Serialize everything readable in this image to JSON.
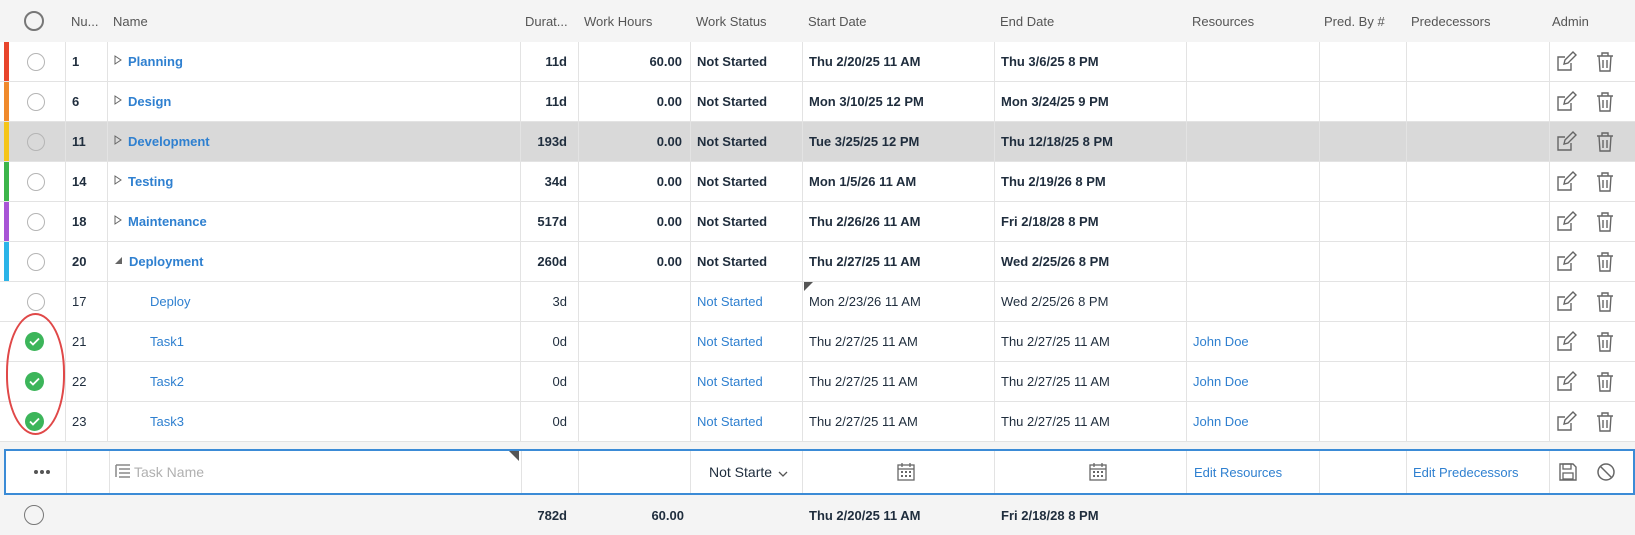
{
  "header": {
    "num": "Nu...",
    "name": "Name",
    "duration": "Durat...",
    "work_hours": "Work Hours",
    "work_status": "Work Status",
    "start_date": "Start Date",
    "end_date": "End Date",
    "resources": "Resources",
    "pred_by": "Pred. By #",
    "predecessors": "Predecessors",
    "admin": "Admin"
  },
  "rows": [
    {
      "num": "1",
      "name": "Planning",
      "duration": "11d",
      "work_hours": "60.00",
      "status": "Not Started",
      "start": "Thu 2/20/25 11 AM",
      "end": "Thu 3/6/25 8 PM",
      "resources": "",
      "color": "#e8452c",
      "expand": "collapsed"
    },
    {
      "num": "6",
      "name": "Design",
      "duration": "11d",
      "work_hours": "0.00",
      "status": "Not Started",
      "start": "Mon 3/10/25 12 PM",
      "end": "Mon 3/24/25 9 PM",
      "resources": "",
      "color": "#f08a2c",
      "expand": "collapsed"
    },
    {
      "num": "11",
      "name": "Development",
      "duration": "193d",
      "work_hours": "0.00",
      "status": "Not Started",
      "start": "Tue 3/25/25 12 PM",
      "end": "Thu 12/18/25 8 PM",
      "resources": "",
      "color": "#f5c518",
      "expand": "collapsed"
    },
    {
      "num": "14",
      "name": "Testing",
      "duration": "34d",
      "work_hours": "0.00",
      "status": "Not Started",
      "start": "Mon 1/5/26 11 AM",
      "end": "Thu 2/19/26 8 PM",
      "resources": "",
      "color": "#3cb54a",
      "expand": "collapsed"
    },
    {
      "num": "18",
      "name": "Maintenance",
      "duration": "517d",
      "work_hours": "0.00",
      "status": "Not Started",
      "start": "Thu 2/26/26 11 AM",
      "end": "Fri 2/18/28 8 PM",
      "resources": "",
      "color": "#a855d6",
      "expand": "collapsed"
    },
    {
      "num": "20",
      "name": "Deployment",
      "duration": "260d",
      "work_hours": "0.00",
      "status": "Not Started",
      "start": "Thu 2/27/25 11 AM",
      "end": "Wed 2/25/26 8 PM",
      "resources": "",
      "color": "#2bb4e8",
      "expand": "expanded"
    },
    {
      "num": "17",
      "name": "Deploy",
      "duration": "3d",
      "work_hours": "",
      "status": "Not Started",
      "start": "Mon 2/23/26 11 AM",
      "end": "Wed 2/25/26 8 PM",
      "resources": "",
      "color": "",
      "expand": "none"
    },
    {
      "num": "21",
      "name": "Task1",
      "duration": "0d",
      "work_hours": "",
      "status": "Not Started",
      "start": "Thu 2/27/25 11 AM",
      "end": "Thu 2/27/25 11 AM",
      "resources": "John Doe",
      "color": "",
      "expand": "none",
      "checked": true
    },
    {
      "num": "22",
      "name": "Task2",
      "duration": "0d",
      "work_hours": "",
      "status": "Not Started",
      "start": "Thu 2/27/25 11 AM",
      "end": "Thu 2/27/25 11 AM",
      "resources": "John Doe",
      "color": "",
      "expand": "none",
      "checked": true
    },
    {
      "num": "23",
      "name": "Task3",
      "duration": "0d",
      "work_hours": "",
      "status": "Not Started",
      "start": "Thu 2/27/25 11 AM",
      "end": "Thu 2/27/25 11 AM",
      "resources": "John Doe",
      "color": "",
      "expand": "none",
      "checked": true
    }
  ],
  "new_row": {
    "name_placeholder": "Task Name",
    "status_value": "Not Starte",
    "edit_resources": "Edit Resources",
    "edit_predecessors": "Edit Predecessors"
  },
  "footer": {
    "duration": "782d",
    "work_hours": "60.00",
    "start": "Thu 2/20/25 11 AM",
    "end": "Fri 2/18/28 8 PM"
  }
}
